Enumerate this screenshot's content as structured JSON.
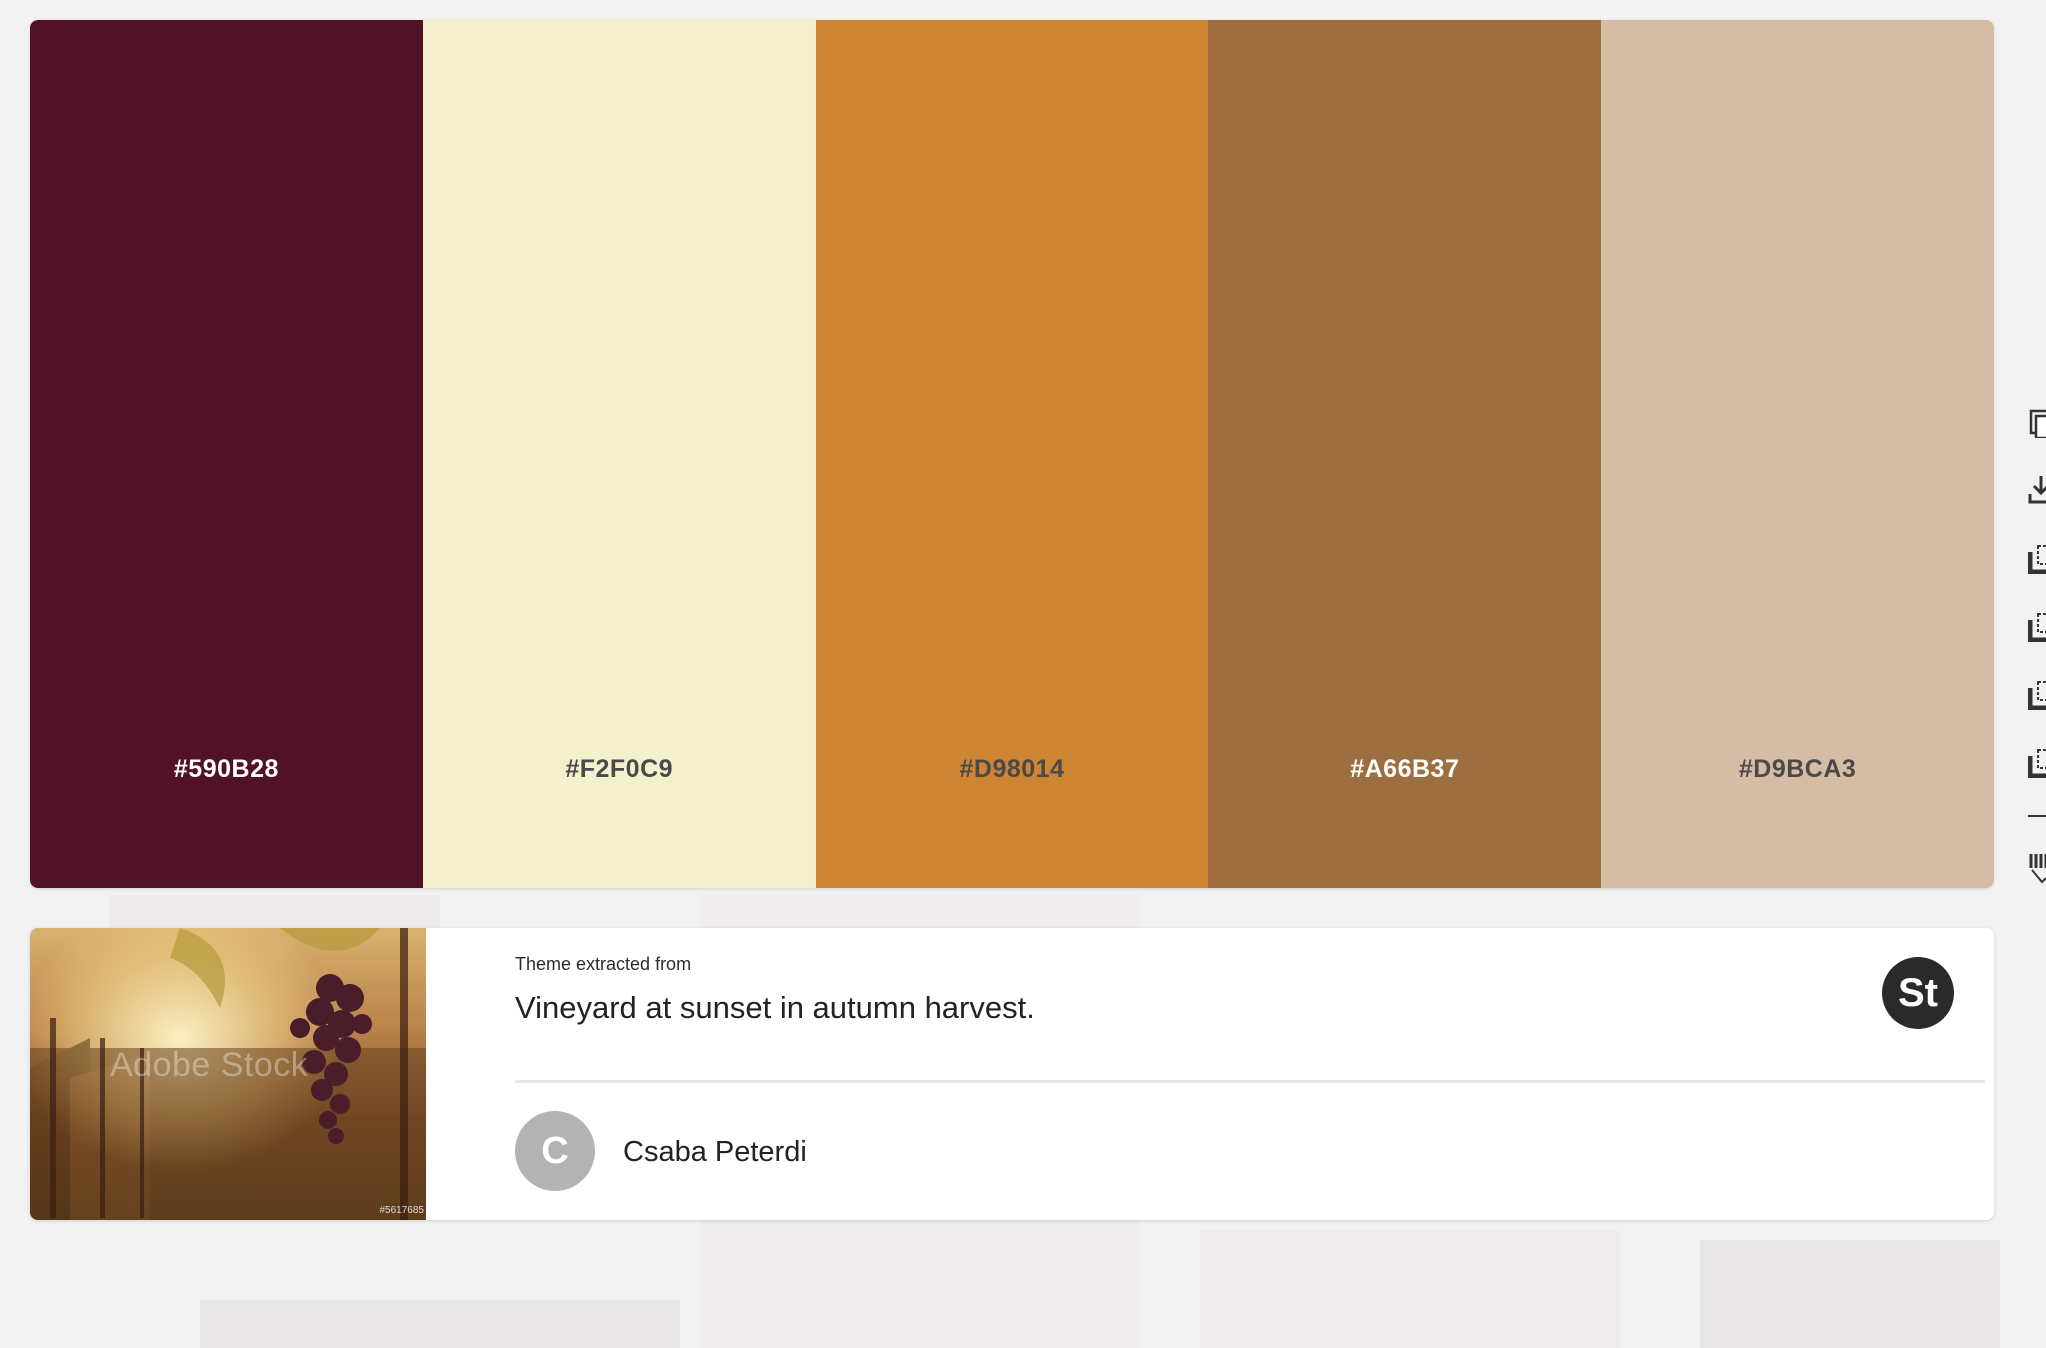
{
  "palette": {
    "swatches": [
      {
        "hex": "#590B28",
        "color": "#511126",
        "label_color": "#ffffff"
      },
      {
        "hex": "#F2F0C9",
        "color": "#f4f0cd",
        "label_color": "#4a4a4a"
      },
      {
        "hex": "#D98014",
        "color": "#cd8533",
        "label_color": "#4a4a4a"
      },
      {
        "hex": "#A66B37",
        "color": "#9d6e3f",
        "label_color": "#ffffff"
      },
      {
        "hex": "#D9BCA3",
        "color": "#d4bca5",
        "label_color": "#4a4a4a"
      }
    ]
  },
  "source": {
    "caption_prefix": "Theme extracted from",
    "title": "Vineyard at sunset in autumn harvest.",
    "watermark": "Adobe Stock",
    "stock_id": "#5617685",
    "badge": "St",
    "author": {
      "initial": "C",
      "name": "Csaba Peterdi"
    }
  },
  "sidebar": {
    "icons": [
      "copy-icon",
      "download-icon",
      "save-to-library-icon",
      "save-to-library-icon",
      "save-to-library-icon",
      "save-to-library-icon",
      "tools-icon"
    ]
  }
}
